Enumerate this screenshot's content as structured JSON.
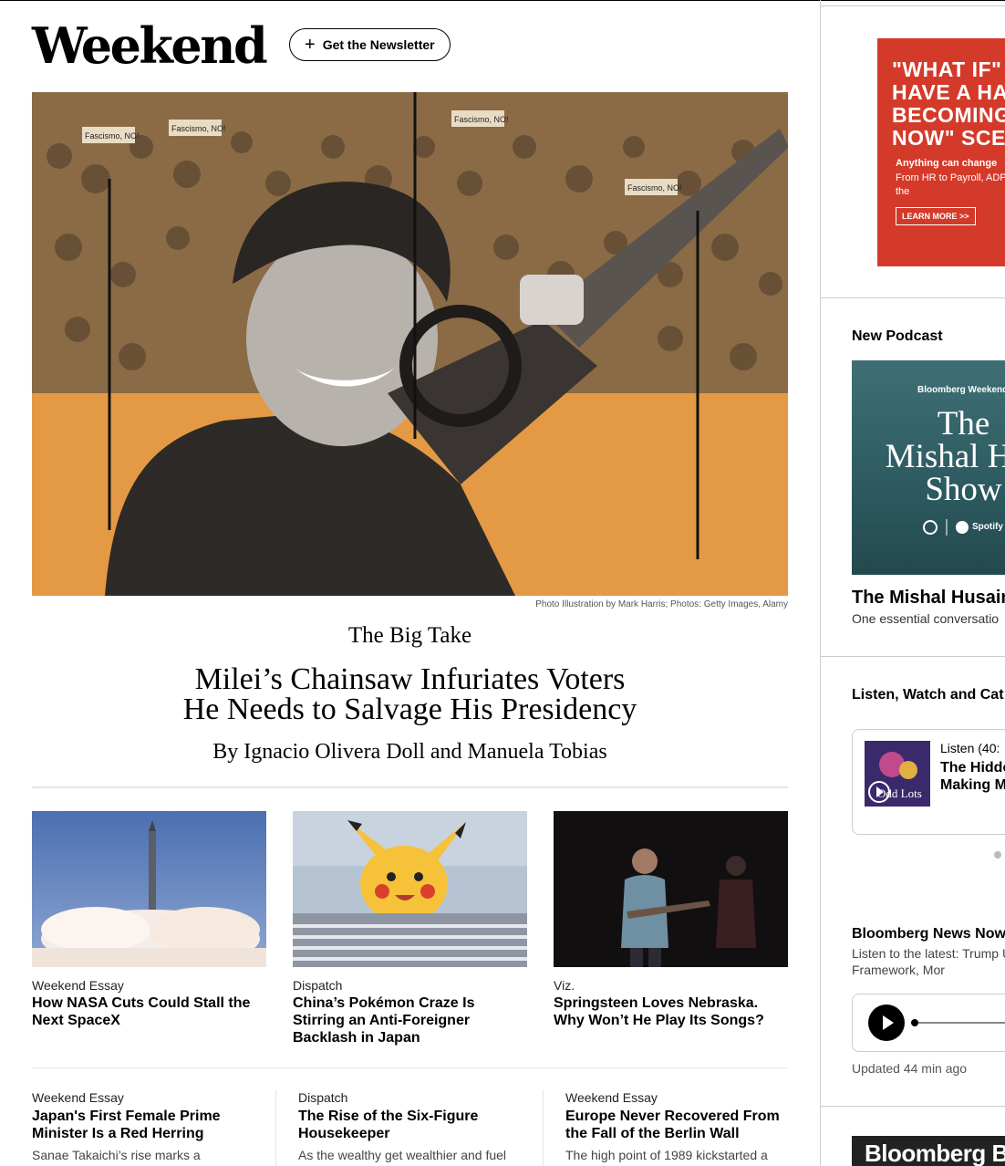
{
  "brand": {
    "logo": "Weekend",
    "newsletter_label": "Get the Newsletter"
  },
  "hero": {
    "caption": "Photo Illustration by Mark Harris; Photos: Getty Images, Alamy",
    "sign_text": "Fascismo, NO!",
    "section": "The Big Take",
    "headline_line1": "Milei’s Chainsaw Infuriates Voters",
    "headline_line2": "He Needs to Salvage His Presidency",
    "byline": "By Ignacio Olivera Doll and Manuela Tobias"
  },
  "cards": [
    {
      "kicker": "Weekend Essay",
      "title": "How NASA Cuts Could Stall the Next SpaceX"
    },
    {
      "kicker": "Dispatch",
      "title": "China’s Pokémon Craze Is Stirring an Anti-Foreigner Backlash in Japan"
    },
    {
      "kicker": "Viz.",
      "title": "Springsteen Loves Nebraska. Why Won’t He Play Its Songs?"
    }
  ],
  "stories": [
    {
      "kicker": "Weekend Essay",
      "title": "Japan's First Female Prime Minister Is a Red Herring",
      "dek": "Sanae Takaichi’s rise marks a"
    },
    {
      "kicker": "Dispatch",
      "title": "The Rise of the Six-Figure Housekeeper",
      "dek": "As the wealthy get wealthier and fuel"
    },
    {
      "kicker": "Weekend Essay",
      "title": "Europe Never Recovered From the Fall of the Berlin Wall",
      "dek": "The high point of 1989 kickstarted a"
    }
  ],
  "rail": {
    "ad": {
      "headline": "“WHAT IF” HAVE A HA BECOMING NOW” SCE",
      "line1": "\"WHAT IF\"",
      "line2": "HAVE A HA",
      "line3": "BECOMING",
      "line4": "NOW\" SCE",
      "sub1": "Anything can change",
      "sub2": "From HR to Payroll, ADP solutions to take on the",
      "cta": "LEARN MORE >>"
    },
    "podcast": {
      "heading": "New Podcast",
      "tag": "Bloomberg Weekend",
      "show_line1": "The",
      "show_line2": "Mishal Hus",
      "show_line3": "Show",
      "spotify": "Spotify",
      "title": "The Mishal Husain",
      "dek": "One essential conversatio"
    },
    "listen": {
      "heading": "Listen, Watch and Cat",
      "meta": "Listen (40:",
      "art_label": "Odd Lots",
      "title_line1": "The Hidde",
      "title_line2": "Making M"
    },
    "news": {
      "heading": "Bloomberg News Now",
      "dek": "Listen to the latest: Trump Up Trade Framework, Mor",
      "updated": "Updated 44 min ago"
    },
    "banner": "Bloomberg B"
  }
}
